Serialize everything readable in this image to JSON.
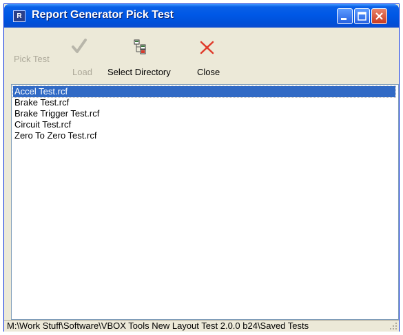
{
  "window": {
    "title": "Report Generator Pick Test",
    "icon": "app-icon"
  },
  "titlebar_buttons": {
    "minimize": "minimize-icon",
    "maximize": "maximize-icon",
    "close": "close-icon"
  },
  "toolbar": {
    "pick_test_label": "Pick Test",
    "load_label": "Load",
    "select_directory_label": "Select Directory",
    "close_label": "Close"
  },
  "list": {
    "items": [
      "Accel Test.rcf",
      "Brake Test.rcf",
      "Brake Trigger Test.rcf",
      "Circuit Test.rcf",
      "Zero To Zero Test.rcf"
    ],
    "selected_index": 0
  },
  "status": {
    "path": "M:\\Work Stuff\\Software\\VBOX Tools New Layout Test 2.0.0 b24\\Saved Tests"
  },
  "colors": {
    "titlebar": "#0058e6",
    "selection": "#316ac5",
    "disabled_text": "#aca899",
    "close_icon": "#e03a2a"
  }
}
